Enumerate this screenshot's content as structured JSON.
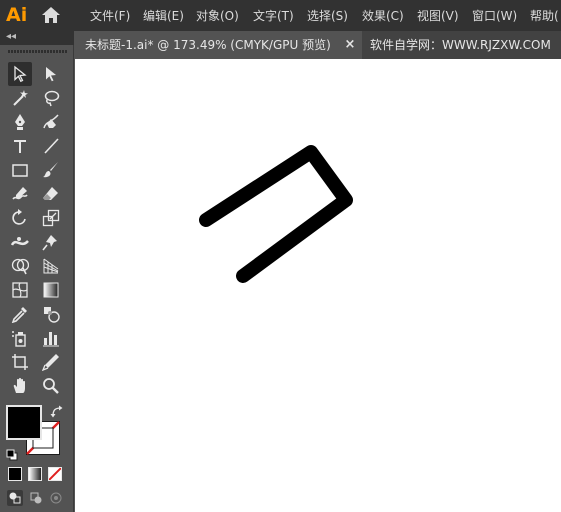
{
  "app": {
    "logo_text": "Ai"
  },
  "menu": [
    {
      "label": "文件(F)"
    },
    {
      "label": "编辑(E)"
    },
    {
      "label": "对象(O)"
    },
    {
      "label": "文字(T)"
    },
    {
      "label": "选择(S)"
    },
    {
      "label": "效果(C)"
    },
    {
      "label": "视图(V)"
    },
    {
      "label": "窗口(W)"
    },
    {
      "label": "帮助("
    }
  ],
  "tabs": {
    "active": {
      "title": "未标题-1.ai* @ 173.49% (CMYK/GPU 预览)",
      "close": "×"
    },
    "secondary": {
      "title": "软件自学网：WWW.RJZXW.COM"
    }
  },
  "panel": {
    "collapse_label": "◂◂"
  },
  "colors": {
    "fill": "#000000",
    "stroke": "none",
    "accent_logo": "#ff9a00",
    "none_slash": "#e02020"
  },
  "tools": [
    "selection-tool",
    "direct-selection-tool",
    "magic-wand-tool",
    "lasso-tool",
    "pen-tool",
    "curvature-tool",
    "type-tool",
    "line-segment-tool",
    "rectangle-tool",
    "paintbrush-tool",
    "shaper-tool",
    "eraser-tool",
    "rotate-tool",
    "scale-tool",
    "width-tool",
    "puppet-warp-tool",
    "shape-builder-tool",
    "perspective-grid-tool",
    "mesh-tool",
    "gradient-tool",
    "eyedropper-tool",
    "blend-tool",
    "symbol-sprayer-tool",
    "column-graph-tool",
    "artboard-tool",
    "slice-tool",
    "hand-tool",
    "zoom-tool"
  ]
}
